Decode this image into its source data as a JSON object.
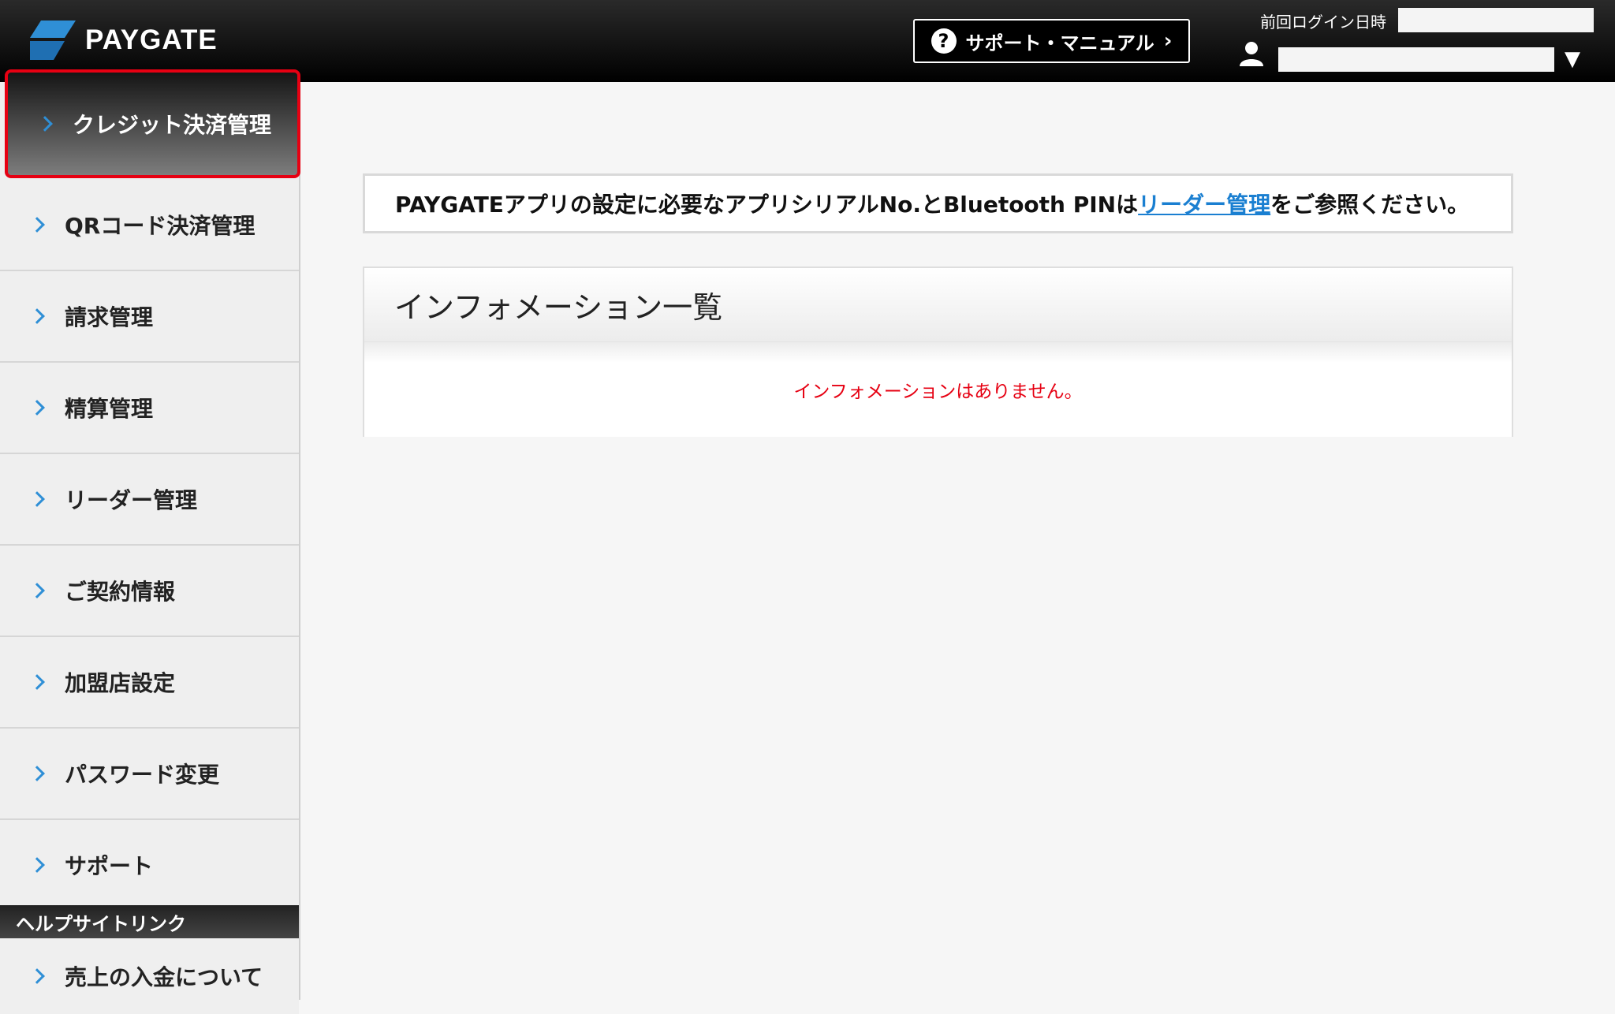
{
  "header": {
    "brand": "PAYGATE",
    "support_label": "サポート・マニュアル",
    "last_login_label": "前回ログイン日時"
  },
  "sidebar": {
    "items": [
      {
        "label": "クレジット決済管理"
      },
      {
        "label": "QRコード決済管理"
      },
      {
        "label": "請求管理"
      },
      {
        "label": "精算管理"
      },
      {
        "label": "リーダー管理"
      },
      {
        "label": "ご契約情報"
      },
      {
        "label": "加盟店設定"
      },
      {
        "label": "パスワード変更"
      },
      {
        "label": "サポート"
      }
    ],
    "help_section_title": "ヘルプサイトリンク",
    "help_items": [
      {
        "label": "売上の入金について"
      }
    ]
  },
  "notice": {
    "text_before": "PAYGATEアプリの設定に必要なアプリシリアルNo.とBluetooth PINは",
    "link_text": "リーダー管理",
    "text_after": "をご参照ください。"
  },
  "info": {
    "title": "インフォメーション一覧",
    "empty_message": "インフォメーションはありません。"
  },
  "colors": {
    "accent_blue": "#2f8fd6",
    "highlight_red": "#e60012",
    "link_blue": "#1a7fd1"
  }
}
